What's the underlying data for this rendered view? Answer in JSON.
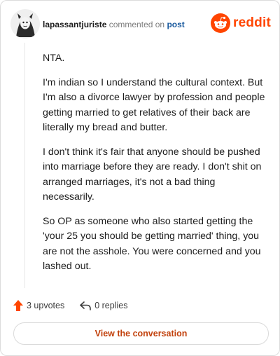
{
  "header": {
    "username": "lapassantjuriste",
    "commented_text": "commented on",
    "post_link": "post",
    "brand": "reddit",
    "brand_color": "#ff4500",
    "avatar_icon": "user-avatar-icon"
  },
  "comment": {
    "paragraphs": [
      "NTA.",
      "I'm indian so I understand the cultural context. But I'm also a divorce lawyer by profession and people getting married to get relatives of their back are literally my bread and butter.",
      "I don't think it's fair that anyone should be pushed into marriage before they are ready. I don't shit on arranged marriages, it's not a bad thing necessarily.",
      "So OP as someone who also started getting the 'your 25 you should be getting married' thing, you are not the asshole. You were concerned and you lashed out."
    ]
  },
  "actions": {
    "upvotes": "3 upvotes",
    "replies": "0 replies",
    "upvote_color": "#ff4500"
  },
  "footer": {
    "view_button": "View the conversation"
  }
}
